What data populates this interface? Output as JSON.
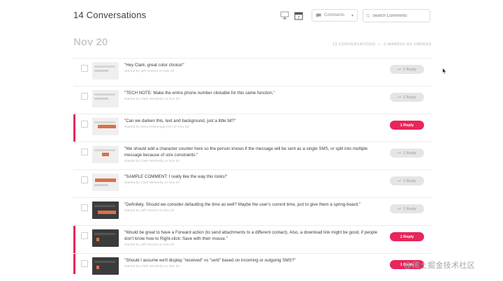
{
  "header": {
    "title": "14 Conversations",
    "filter": {
      "selected": "Comments"
    },
    "search": {
      "placeholder": "Search Comments"
    }
  },
  "section": {
    "date": "Nov 20",
    "summary_count": "12 CONVERSATIONS",
    "summary_unread": "0 MARKED AS UNREAD"
  },
  "rows": [
    {
      "text": "\"Hey Clark, great color choice!\"",
      "meta": "Started by Jeff Vincent on Nov 20",
      "reply": "1 Reply",
      "unread": false
    },
    {
      "text": "\"TECH NOTE: Make the entire phone number clickable for this same function.\"",
      "meta": "Started by Clark Wimberly on Nov 20",
      "reply": "1 Reply",
      "unread": false
    },
    {
      "text": "\"Can we darken this, text and background, just a little bit?\"",
      "meta": "Started by www.invisionapp.com on Nov 20",
      "reply": "1 Reply",
      "unread": true
    },
    {
      "text": "\"We should add a character counter here so the person knows if the message will be sent as a single SMS, or split into multiple message because of size constraints.\"",
      "meta": "Started by Clark Wimberly on Nov 20",
      "reply": "1 Reply",
      "unread": false
    },
    {
      "text": "\"SAMPLE COMMENT: I really like the way this looks!\"",
      "meta": "Started by Clark Wimberly on Nov 20",
      "reply": "1 Reply",
      "unread": false
    },
    {
      "text": "\"Definitely. Should we consider defaulting the time as well? Maybe the user's current time, just to give them a spring-board.\"",
      "meta": "Started by Jeff Vincent on Nov 20",
      "reply": "1 Reply",
      "unread": false
    },
    {
      "text": "\"Would be great to have a Forward action (to send attachments to a different contact). Also, a download link might be good, if people don't know how to Right-click: Save with their mouse.\"",
      "meta": "Started by Jeff Vincent on Nov 20",
      "reply": "1 Reply",
      "unread": true
    },
    {
      "text": "\"Should I assume we'll display \"received\" vs \"sent\" based on incoming or outgoing SMS?\"",
      "meta": "Started by Clark Wimberly on Nov 20",
      "reply": "1 Reply",
      "unread": true
    }
  ],
  "watermark": "@稀土掘金技术社区",
  "colors": {
    "accent": "#e8265b",
    "muted": "#e4e5e7",
    "date": "#c9ccd1"
  },
  "icons": [
    "desktop-icon",
    "calendar-icon",
    "comment-icon",
    "search-icon",
    "reply-icon",
    "chevron-down-icon"
  ]
}
